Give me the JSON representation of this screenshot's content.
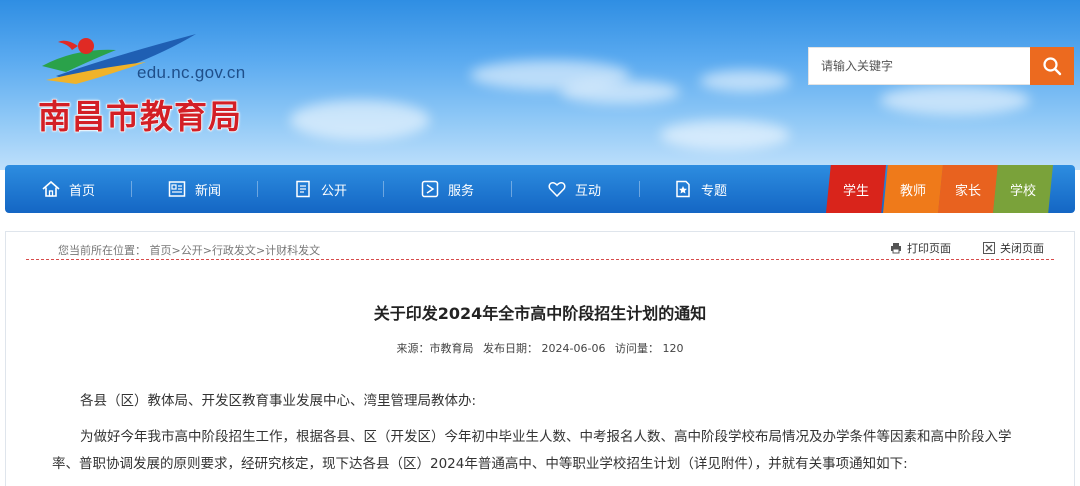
{
  "header": {
    "domain": "edu.nc.gov.cn",
    "title": "南昌市教育局",
    "search": {
      "placeholder": "请输入关键字",
      "icon": "search-icon"
    }
  },
  "nav": {
    "items": [
      {
        "label": "首页",
        "icon": "home-icon"
      },
      {
        "label": "新闻",
        "icon": "newspaper-icon"
      },
      {
        "label": "公开",
        "icon": "document-list-icon"
      },
      {
        "label": "服务",
        "icon": "service-arrow-icon"
      },
      {
        "label": "互动",
        "icon": "heart-icon"
      },
      {
        "label": "专题",
        "icon": "star-document-icon"
      }
    ],
    "tabs": [
      {
        "label": "学生",
        "color": "#d9241b"
      },
      {
        "label": "教师",
        "color": "#ef7a1a"
      },
      {
        "label": "家长",
        "color": "#e8621f"
      },
      {
        "label": "学校",
        "color": "#7aa23a"
      }
    ]
  },
  "breadcrumb": {
    "prefix": "您当前所在位置：",
    "items": [
      "首页",
      "公开",
      "行政发文",
      "计财科发文"
    ],
    "separator": ">"
  },
  "actions": {
    "print": "打印页面",
    "close": "关闭页面"
  },
  "article": {
    "title": "关于印发2024年全市高中阶段招生计划的通知",
    "meta": {
      "source": "来源：市教育局",
      "date": "发布日期：  2024-06-06",
      "views": "访问量：  120"
    },
    "paragraphs": [
      "各县（区）教体局、开发区教育事业发展中心、湾里管理局教体办:",
      "为做好今年我市高中阶段招生工作，根据各县、区（开发区）今年初中毕业生人数、中考报名人数、高中阶段学校布局情况及办学条件等因素和高中阶段入学率、普职协调发展的原则要求，经研究核定，现下达各县（区）2024年普通高中、中等职业学校招生计划（详见附件），并就有关事项通知如下:"
    ]
  },
  "colors": {
    "brand_red": "#d31f26",
    "nav_blue": "#1466c4",
    "search_orange": "#ec6a1f"
  }
}
